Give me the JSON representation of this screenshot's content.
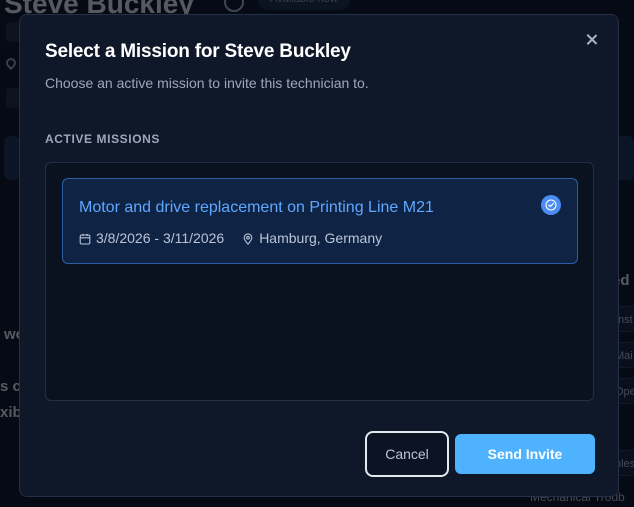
{
  "background": {
    "technician_name": "Steve Buckley",
    "availability_badge": "Available now",
    "fragment_wo": "wo",
    "fragment_sc": "s c",
    "fragment_xib": "xib",
    "fragment_ed": "ed",
    "chip_1": "Inst",
    "chip_2": "Mai",
    "chip_3": "Ope",
    "chip_4": "nles",
    "bottom_text": "Mechanical Troub"
  },
  "modal": {
    "title": "Select a Mission for Steve Buckley",
    "subtitle": "Choose an active mission to invite this technician to.",
    "section_label": "ACTIVE MISSIONS",
    "missions": [
      {
        "title": "Motor and drive replacement on Printing Line M21",
        "dates": "3/8/2026 - 3/11/2026",
        "location": "Hamburg, Germany",
        "selected": true
      }
    ],
    "cancel_label": "Cancel",
    "send_label": "Send Invite"
  },
  "colors": {
    "accent": "#4fb2ff",
    "selected_border": "#2f5ea6",
    "mission_title": "#5fa6ff",
    "modal_bg": "#0f1829"
  },
  "icons": {
    "close": "close-icon",
    "calendar": "calendar-icon",
    "location": "map-pin-icon",
    "selected": "check-circle-icon"
  }
}
